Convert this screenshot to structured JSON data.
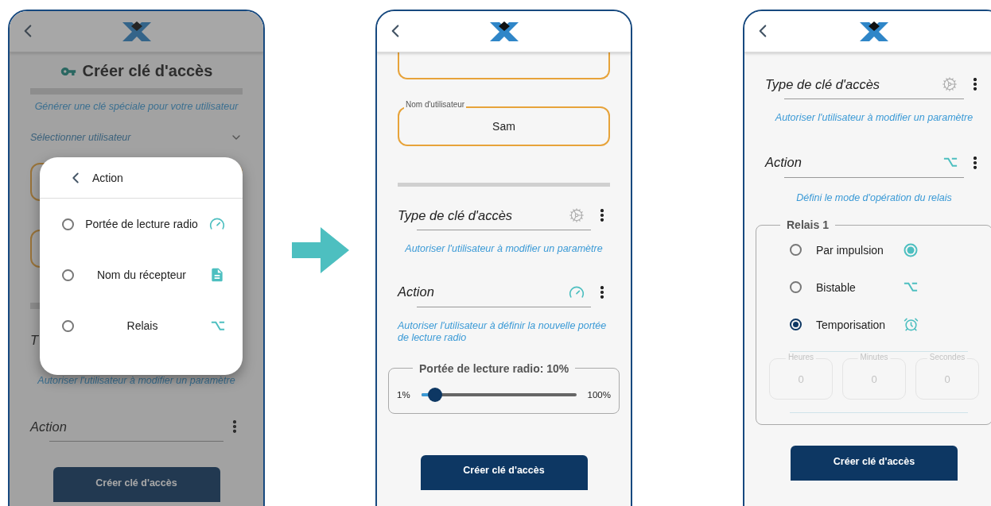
{
  "screens": [
    {
      "kind": "modal",
      "title": "Créer clé d'accès",
      "subtitle": "Générer une clé spéciale pour votre utilisateur",
      "select": {
        "placeholder": "Sélectionner utilisateur"
      },
      "partial_label": "T",
      "hint": "Autoriser l'utilisateur à modifier un paramètre",
      "action_label": "Action",
      "button": "Créer clé d'accès",
      "dialog": {
        "title": "Action",
        "options": [
          {
            "label": "Portée de lecture radio",
            "selected": false
          },
          {
            "label": "Nom du récepteur",
            "selected": false
          },
          {
            "label": "Relais",
            "selected": false
          }
        ]
      }
    },
    {
      "kind": "range",
      "username": {
        "label": "Nom d'utilisateur",
        "value": "Sam"
      },
      "type_label": "Type de clé d'accès",
      "type_hint": "Autoriser l'utilisateur à modifier un paramètre",
      "action_label": "Action",
      "action_hint": "Autoriser l'utilisateur à définir la nouvelle portée de lecture radio",
      "range": {
        "title": "Portée de lecture radio: 10%",
        "min": "1%",
        "max": "100%",
        "level": 0.09
      },
      "button": "Créer clé d'accès"
    },
    {
      "kind": "relay",
      "type_label": "Type de clé d'accès",
      "type_hint": "Autoriser l'utilisateur à modifier un paramètre",
      "action_label": "Action",
      "action_hint": "Défini le mode d'opération du relais",
      "relay": {
        "title": "Relais 1",
        "modes": [
          {
            "label": "Par impulsion",
            "selected": false
          },
          {
            "label": "Bistable",
            "selected": false
          },
          {
            "label": "Temporisation",
            "selected": true
          }
        ],
        "timers": [
          {
            "label": "Heures",
            "value": "0",
            "disabled": true
          },
          {
            "label": "Minutes",
            "value": "0",
            "disabled": true
          },
          {
            "label": "Secondes",
            "value": "0",
            "disabled": true
          }
        ]
      },
      "button": "Créer clé d'accès"
    }
  ]
}
